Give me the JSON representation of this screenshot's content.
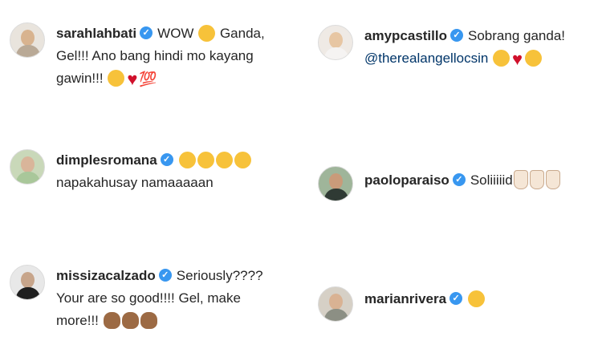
{
  "comments": [
    {
      "user": "sarahlahbati",
      "parts": [
        "WOW",
        "Ganda,",
        "Gel!!! Ano bang hindi mo kayang",
        "gawin!!!"
      ]
    },
    {
      "user": "amypcastillo",
      "text": "Sobrang ganda!",
      "mention": "@therealangellocsin"
    },
    {
      "user": "dimplesromana",
      "text": "napakahusay namaaaaan"
    },
    {
      "user": "paoloparaiso",
      "text": "Soliiiiid"
    },
    {
      "user": "missizacalzado",
      "lines": [
        "Seriously????",
        "Your are so good!!!! Gel, make",
        "more!!!"
      ]
    },
    {
      "user": "marianrivera"
    }
  ],
  "icons": {
    "verified": "✓",
    "heart": "♥",
    "hundred": "💯"
  },
  "colors": {
    "verified": "#3897f0",
    "mention": "#003569"
  }
}
